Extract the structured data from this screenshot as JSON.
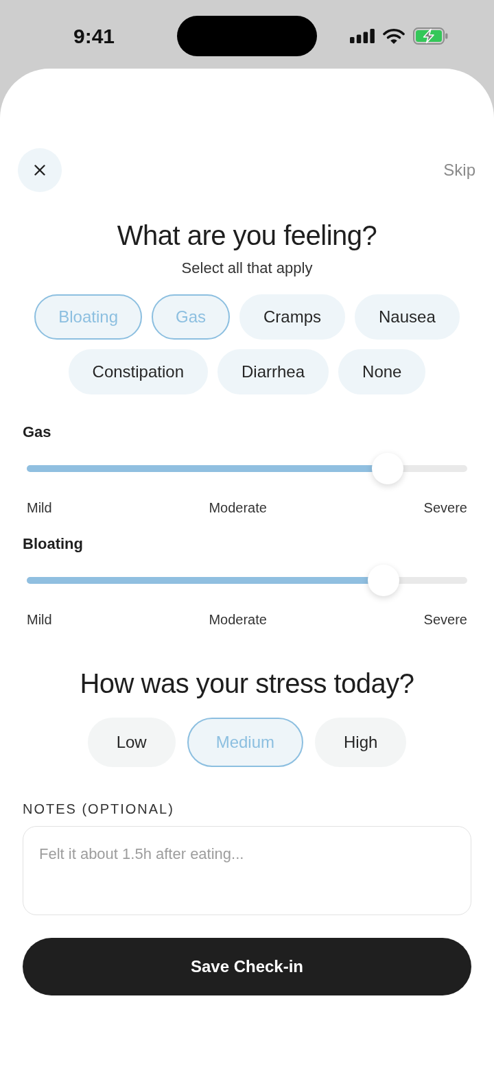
{
  "status_bar": {
    "time": "9:41"
  },
  "header": {
    "skip": "Skip"
  },
  "symptoms": {
    "title": "What are you feeling?",
    "subtitle": "Select all that apply",
    "options": [
      {
        "label": "Bloating",
        "selected": true
      },
      {
        "label": "Gas",
        "selected": true
      },
      {
        "label": "Cramps",
        "selected": false
      },
      {
        "label": "Nausea",
        "selected": false
      },
      {
        "label": "Constipation",
        "selected": false
      },
      {
        "label": "Diarrhea",
        "selected": false
      },
      {
        "label": "None",
        "selected": false
      }
    ]
  },
  "severity": [
    {
      "label": "Gas",
      "level": 0.82,
      "scale": [
        "Mild",
        "Moderate",
        "Severe"
      ]
    },
    {
      "label": "Bloating",
      "level": 0.81,
      "scale": [
        "Mild",
        "Moderate",
        "Severe"
      ]
    }
  ],
  "stress": {
    "title": "How was your stress today?",
    "options": [
      {
        "label": "Low",
        "selected": false
      },
      {
        "label": "Medium",
        "selected": true
      },
      {
        "label": "High",
        "selected": false
      }
    ]
  },
  "notes": {
    "label": "NOTES (OPTIONAL)",
    "placeholder": "Felt it about 1.5h after eating..."
  },
  "save_button": "Save Check-in"
}
